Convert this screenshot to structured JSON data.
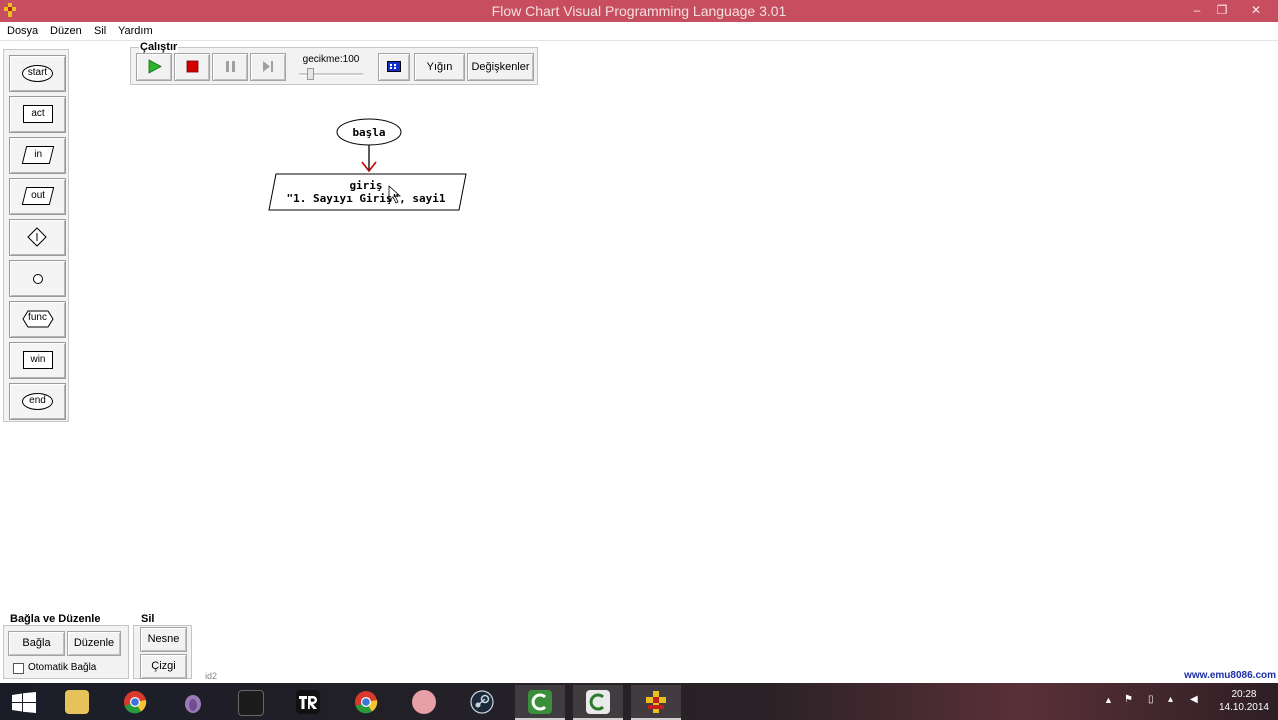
{
  "window": {
    "title": "Flow Chart Visual Programming Language 3.01",
    "minimize_glyph": "–",
    "restore_glyph": "❐",
    "close_glyph": "✕"
  },
  "menu": [
    "Dosya",
    "Düzen",
    "Sil",
    "Yardım"
  ],
  "palette": [
    {
      "id": "start",
      "label": "start",
      "shape": "oval"
    },
    {
      "id": "act",
      "label": "act",
      "shape": "rect"
    },
    {
      "id": "in",
      "label": "in",
      "shape": "parallelogram"
    },
    {
      "id": "out",
      "label": "out",
      "shape": "parallelogram"
    },
    {
      "id": "if",
      "label": "",
      "shape": "diamond"
    },
    {
      "id": "connector",
      "label": "",
      "shape": "circle"
    },
    {
      "id": "func",
      "label": "func",
      "shape": "hexagon"
    },
    {
      "id": "win",
      "label": "win",
      "shape": "rect"
    },
    {
      "id": "end",
      "label": "end",
      "shape": "oval"
    }
  ],
  "run_group": {
    "title": "Çalıştır",
    "delay_label": "gecikme:100",
    "stack_label": "Yığın",
    "variables_label": "Değişkenler",
    "play_color": "#2bb52b",
    "stop_color": "#d40000"
  },
  "flowchart": {
    "start_node": "başla",
    "input_node_line1": "giriş",
    "input_node_line2": "\"1. Sayıyı Giriş\", sayi1",
    "arrow_color": "#c00000"
  },
  "connect_group": {
    "title": "Bağla ve Düzenle",
    "connect_label": "Bağla",
    "edit_label": "Düzenle",
    "auto_connect_label": "Otomatik Bağla",
    "auto_connect_checked": false
  },
  "delete_group": {
    "title": "Sil",
    "object_label": "Nesne",
    "line_label": "Çizgi"
  },
  "status_id": "id2",
  "watermark": "www.emu8086.com",
  "taskbar": {
    "apps": [
      "start-icon",
      "file-explorer-icon",
      "chrome-icon",
      "tor-icon",
      "ghost-game-icon",
      "tr-app-icon",
      "chrome-alt-icon",
      "brain-icon",
      "steam-icon",
      "camtasia-icon",
      "camtasia-recorder-icon",
      "flowchart-app-icon"
    ],
    "time": "20:28",
    "date": "14.10.2014"
  }
}
